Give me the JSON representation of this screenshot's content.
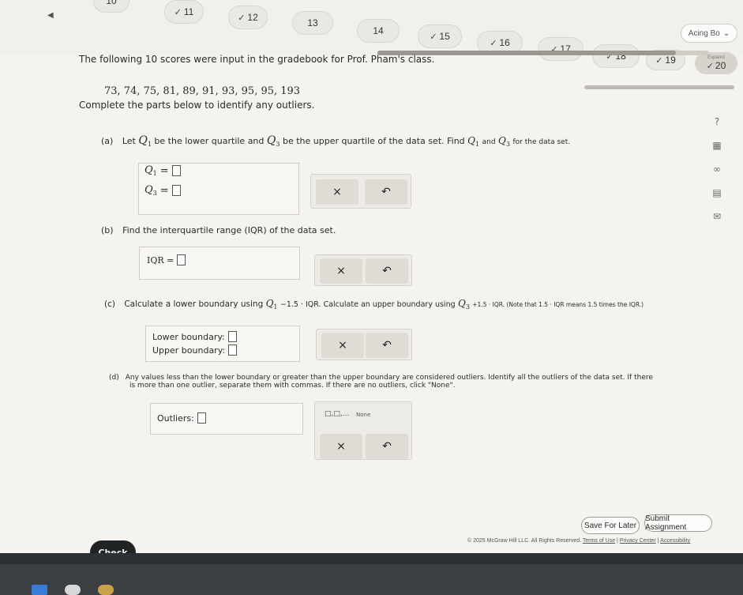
{
  "nav": {
    "partial_label": "10",
    "questions": [
      {
        "num": "11",
        "done": true
      },
      {
        "num": "12",
        "done": true
      },
      {
        "num": "13",
        "done": false
      },
      {
        "num": "14",
        "done": false
      },
      {
        "num": "15",
        "done": true
      },
      {
        "num": "16",
        "done": true
      },
      {
        "num": "17",
        "done": true
      },
      {
        "num": "18",
        "done": true
      },
      {
        "num": "19",
        "done": true
      },
      {
        "num": "20",
        "done": true
      }
    ],
    "current_tag": "Espanol",
    "user_name": "Acing Bo"
  },
  "problem": {
    "intro": "The following 10 scores were input in the gradebook for Prof. Pham's class.",
    "scores": "73, 74, 75, 81, 89, 91, 93, 95, 95, 193",
    "instruction": "Complete the parts below to identify any outliers."
  },
  "parts": {
    "a": {
      "label": "(a)",
      "text1": "Let",
      "q1": "Q",
      "q1_sub": "1",
      "text2": "be the lower quartile and",
      "q3": "Q",
      "q3_sub": "3",
      "text3": "be the upper quartile of the data set. Find",
      "text4": "and",
      "text5": "for the data set.",
      "row1_label": "Q",
      "row1_sub": "1",
      "row2_label": "Q",
      "row2_sub": "3",
      "eq": "="
    },
    "b": {
      "label": "(b)",
      "text": "Find the interquartile range (IQR) of the data set.",
      "row_label": "IQR ="
    },
    "c": {
      "label": "(c)",
      "text1": "Calculate a lower boundary using",
      "formula1": "Q",
      "formula1_sub": "1",
      "formula1_rest": "−1.5 · IQR. Calculate an upper boundary using",
      "formula2": "Q",
      "formula2_sub": "3",
      "formula2_rest": "+1.5 · IQR. (Note that 1.5 · IQR means 1.5 times the IQR.)",
      "lower_label": "Lower boundary:",
      "upper_label": "Upper boundary:"
    },
    "d": {
      "label": "(d)",
      "text1": "Any values less than the lower boundary or greater than the upper boundary are considered outliers. Identify all the outliers of the data set. If there",
      "text2": "is more than one outlier, separate them with commas. If there are no outliers, click \"None\".",
      "outliers_label": "Outliers:",
      "none_label": "None",
      "list_tool": "□,□,..."
    }
  },
  "buttons": {
    "clear": "×",
    "undo": "↶",
    "save_later": "Save For Later",
    "submit": "Submit Assignment",
    "check": "Check"
  },
  "tools": [
    "?",
    "▦",
    "∞",
    "▤",
    "✉"
  ],
  "footer": {
    "copyright": "© 2025 McGraw Hill LLC. All Rights Reserved.",
    "terms": "Terms of Use",
    "privacy": "Privacy Center",
    "accessibility": "Accessibility"
  }
}
